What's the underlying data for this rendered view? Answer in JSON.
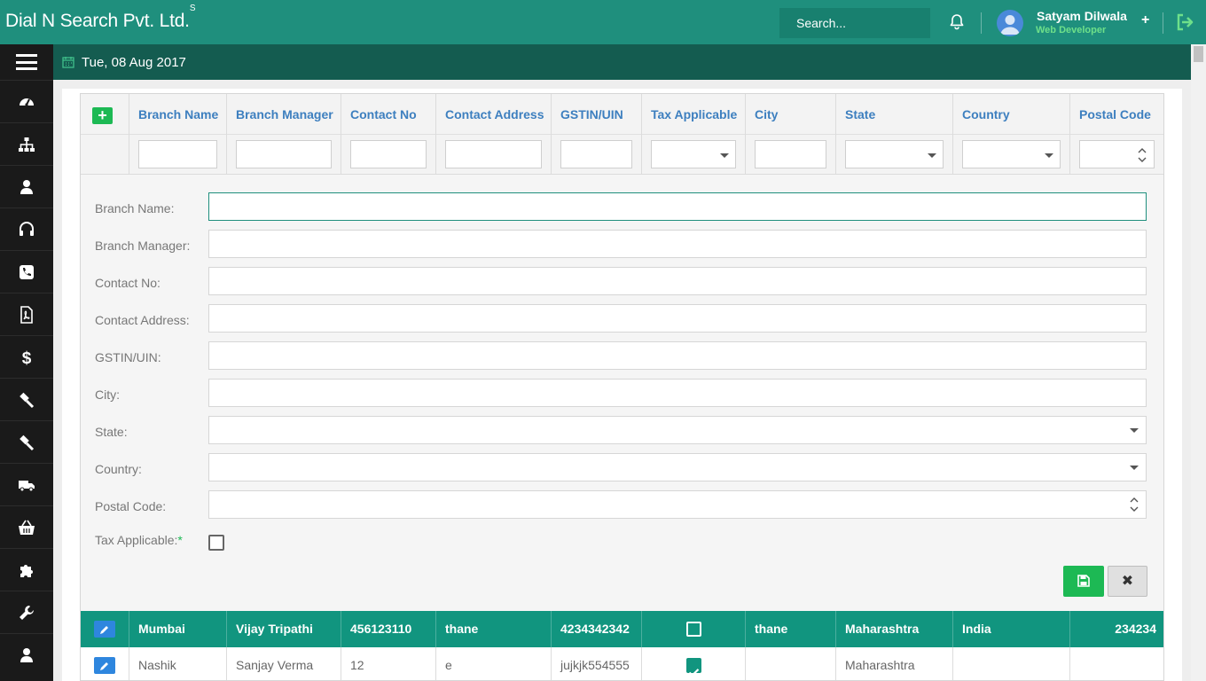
{
  "app": {
    "brand": "Dial N Search Pvt. Ltd.",
    "brand_sup": "S"
  },
  "topbar": {
    "search_placeholder": "Search...",
    "user_name": "Satyam Dilwala",
    "user_role": "Web Developer",
    "plus_label": "+"
  },
  "datebar": {
    "date": "Tue, 08 Aug 2017"
  },
  "sidebar": {
    "items": [
      "dashboard-icon",
      "org-chart-icon",
      "user-icon",
      "headset-icon",
      "phone-icon",
      "pdf-icon",
      "dollar-icon",
      "gavel-icon",
      "gavel-icon",
      "truck-icon",
      "basket-icon",
      "puzzle-icon",
      "wrench-icon",
      "user-icon"
    ]
  },
  "grid": {
    "columns": [
      "Branch Name",
      "Branch Manager",
      "Contact No",
      "Contact Address",
      "GSTIN/UIN",
      "Tax Applicable",
      "City",
      "State",
      "Country",
      "Postal Code"
    ],
    "rows": [
      {
        "branch_name": "Mumbai",
        "branch_manager": "Vijay Tripathi",
        "contact_no": "456123110",
        "contact_address": "thane",
        "gstin": "4234342342",
        "tax_applicable": false,
        "city": "thane",
        "state": "Maharashtra",
        "country": "India",
        "postal_code": "234234"
      },
      {
        "branch_name": "Nashik",
        "branch_manager": "Sanjay Verma",
        "contact_no": "12",
        "contact_address": "e",
        "gstin": "jujkjk554555",
        "tax_applicable": true,
        "city": "",
        "state": "Maharashtra",
        "country": "",
        "postal_code": ""
      }
    ]
  },
  "form": {
    "branch_name": "Branch Name:",
    "branch_manager": "Branch Manager:",
    "contact_no": "Contact No:",
    "contact_address": "Contact Address:",
    "gstin": "GSTIN/UIN:",
    "city": "City:",
    "state": "State:",
    "country": "Country:",
    "postal_code": "Postal Code:",
    "tax_applicable": "Tax Applicable:",
    "required_mark": "*",
    "cancel_label": "✖"
  },
  "colors": {
    "primary": "#1f8f7d",
    "selected_row": "#11957f",
    "green": "#1db954",
    "blue": "#2e86de"
  }
}
